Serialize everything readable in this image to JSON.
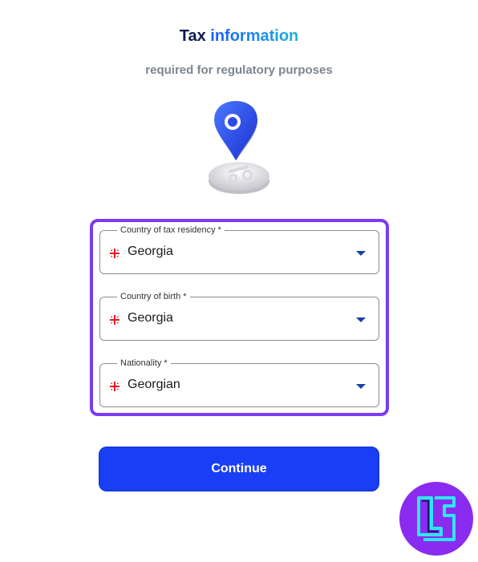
{
  "header": {
    "title_plain": "Tax ",
    "title_accent": "information",
    "subtitle": "required for regulatory purposes"
  },
  "illustration": {
    "icon": "location-pin-percent-icon"
  },
  "form": {
    "fields": [
      {
        "label": "Country of tax residency *",
        "value": "Georgia",
        "flag": "georgia-flag-icon"
      },
      {
        "label": "Country of birth *",
        "value": "Georgia",
        "flag": "georgia-flag-icon"
      },
      {
        "label": "Nationality *",
        "value": "Georgian",
        "flag": "georgia-flag-icon"
      }
    ],
    "highlight_color": "#7a3cf0"
  },
  "actions": {
    "continue_label": "Continue",
    "button_color": "#1a3ef5"
  },
  "watermark": {
    "icon": "brand-logo-icon"
  }
}
